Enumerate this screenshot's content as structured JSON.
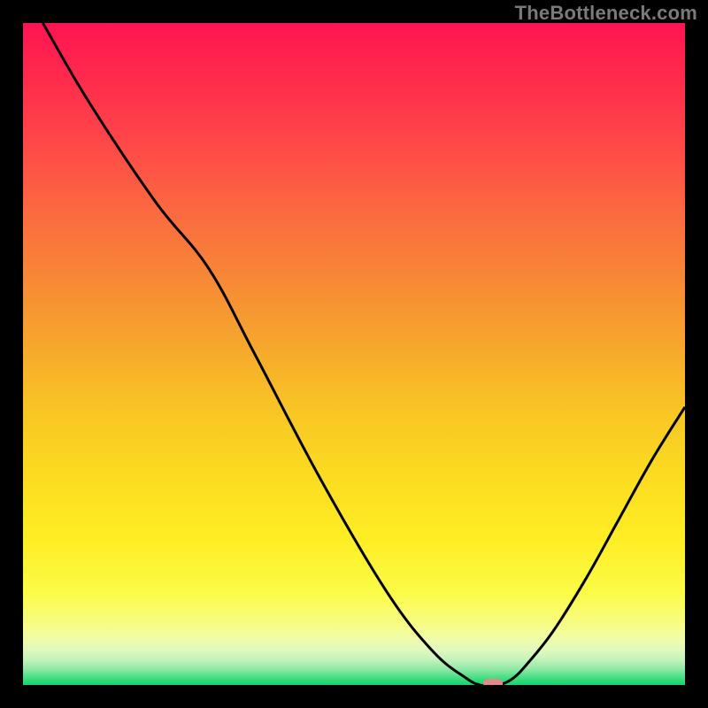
{
  "watermark": "TheBottleneck.com",
  "chart_data": {
    "type": "line",
    "title": "",
    "xlabel": "",
    "ylabel": "",
    "xlim": [
      0,
      100
    ],
    "ylim": [
      0,
      100
    ],
    "grid": false,
    "series": [
      {
        "name": "curve",
        "x": [
          3,
          10,
          20,
          28,
          35,
          45,
          55,
          62,
          67,
          69,
          70,
          71,
          72,
          74,
          76,
          80,
          85,
          90,
          95,
          100
        ],
        "y": [
          100,
          88,
          73,
          63,
          50,
          31,
          14,
          5,
          1,
          0,
          0,
          0,
          0,
          1,
          3,
          8,
          16,
          25,
          34,
          42
        ]
      }
    ],
    "marker": {
      "x": 71,
      "y": 0,
      "color": "#e08a8a"
    },
    "background_gradient": {
      "stops": [
        {
          "offset": 0.0,
          "color": "#ff1452"
        },
        {
          "offset": 0.08,
          "color": "#ff2a4d"
        },
        {
          "offset": 0.18,
          "color": "#ff4748"
        },
        {
          "offset": 0.28,
          "color": "#fb6841"
        },
        {
          "offset": 0.38,
          "color": "#f78637"
        },
        {
          "offset": 0.48,
          "color": "#f6a52d"
        },
        {
          "offset": 0.58,
          "color": "#f8c425"
        },
        {
          "offset": 0.68,
          "color": "#fbdb20"
        },
        {
          "offset": 0.78,
          "color": "#feee24"
        },
        {
          "offset": 0.86,
          "color": "#fbfb48"
        },
        {
          "offset": 0.9,
          "color": "#f8fc7a"
        },
        {
          "offset": 0.925,
          "color": "#f2fda2"
        },
        {
          "offset": 0.945,
          "color": "#e4fabc"
        },
        {
          "offset": 0.96,
          "color": "#c8f3bd"
        },
        {
          "offset": 0.975,
          "color": "#94eaa8"
        },
        {
          "offset": 0.99,
          "color": "#3fde81"
        },
        {
          "offset": 1.0,
          "color": "#16d46b"
        }
      ]
    }
  }
}
